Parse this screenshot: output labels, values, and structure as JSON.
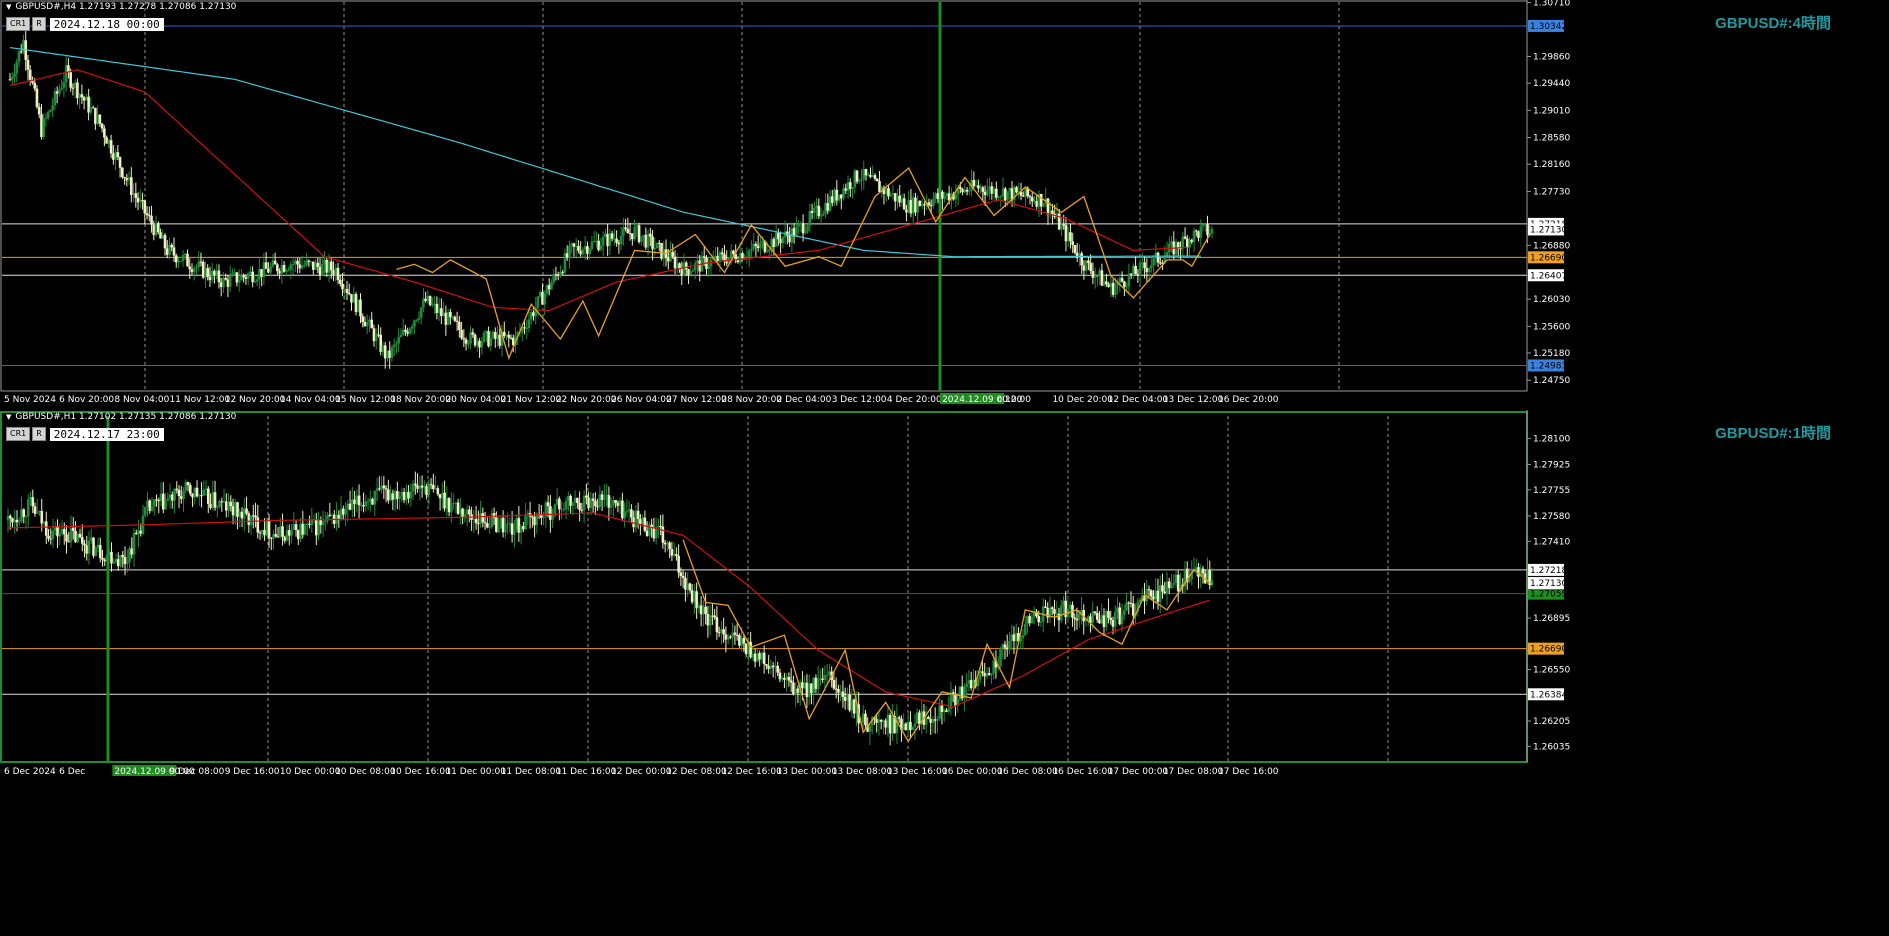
{
  "colors": {
    "bull": "#1e8c3c",
    "bear": "#f0f0c0",
    "ma_fast": "#d01010",
    "ma_slow": "#3fc8d8",
    "zigzag": "#e8a21c",
    "grid": "#c8c8c8",
    "accent_label": "#1e9aa0",
    "blue_line": "#2f66c8",
    "orange_line": "#e89a20",
    "green_vline": "#1e8c1e"
  },
  "panels": [
    {
      "id": "h4",
      "header": "GBPUSD#,H4  1.27193 1.27278 1.27086 1.27130",
      "btn1": "CR1",
      "btn2": "R",
      "datetime": "2024.12.18 00:00",
      "title": "GBPUSD#:4時間",
      "ylim": [
        1.2458,
        1.3072
      ],
      "yticks": [
        "1.30710",
        "1.29860",
        "1.29440",
        "1.29010",
        "1.28580",
        "1.28160",
        "1.27730",
        "1.26880",
        "1.26030",
        "1.25600",
        "1.25180",
        "1.24750"
      ],
      "xticks": [
        "5 Nov 2024",
        "6 Nov 20:00",
        "8 Nov 04:00",
        "11 Nov 12:00",
        "12 Nov 20:00",
        "14 Nov 04:00",
        "15 Nov 12:00",
        "18 Nov 20:00",
        "20 Nov 04:00",
        "21 Nov 12:00",
        "22 Nov 20:00",
        "26 Nov 04:00",
        "27 Nov 12:00",
        "28 Nov 20:00",
        "2 Dec 04:00",
        "3 Dec 12:00",
        "4 Dec 20:00",
        "2024.12.09 00:00",
        "c 12:00",
        "10 Dec 20:00",
        "12 Dec 04:00",
        "13 Dec 12:00",
        "16 Dec 20:00"
      ],
      "hlines": [
        {
          "label": "1.30342",
          "value": 1.30342,
          "kind": "blue"
        },
        {
          "label": "1.27218",
          "value": 1.27218,
          "kind": "white"
        },
        {
          "label": "1.26690",
          "value": 1.2669,
          "kind": "orange"
        },
        {
          "label": "1.26407",
          "value": 1.26407,
          "kind": "white"
        },
        {
          "label": "1.24983",
          "value": 1.24983,
          "kind": "blue"
        }
      ],
      "price_tag": "1.27130",
      "price_value": 1.2713
    },
    {
      "id": "h1",
      "header": "GBPUSD#,H1  1.27102 1.27135 1.27086 1.27130",
      "btn1": "CR1",
      "btn2": "R",
      "datetime": "2024.12.17 23:00",
      "title": "GBPUSD#:1時間",
      "ylim": [
        1.2593,
        1.2825
      ],
      "yticks": [
        "1.28100",
        "1.27925",
        "1.27755",
        "1.27580",
        "1.27410",
        "1.26895",
        "1.26550",
        "1.26205",
        "1.26035"
      ],
      "xticks": [
        "6 Dec 2024",
        "6 Dec",
        "2024.12.09 00:00",
        "9 Dec 08:00",
        "9 Dec 16:00",
        "10 Dec 00:00",
        "10 Dec 08:00",
        "10 Dec 16:00",
        "11 Dec 00:00",
        "11 Dec 08:00",
        "11 Dec 16:00",
        "12 Dec 00:00",
        "12 Dec 08:00",
        "12 Dec 16:00",
        "13 Dec 00:00",
        "13 Dec 08:00",
        "13 Dec 16:00",
        "16 Dec 00:00",
        "16 Dec 08:00",
        "16 Dec 16:00",
        "17 Dec 00:00",
        "17 Dec 08:00",
        "17 Dec 16:00"
      ],
      "hlines": [
        {
          "label": "1.27218",
          "value": 1.27218,
          "kind": "white"
        },
        {
          "label": "1.27059",
          "value": 1.27059,
          "kind": "green"
        },
        {
          "label": "1.26690",
          "value": 1.2669,
          "kind": "orange"
        },
        {
          "label": "1.26384",
          "value": 1.26384,
          "kind": "white"
        }
      ],
      "price_tag": "1.27130",
      "price_value": 1.2713
    }
  ],
  "chart_data": [
    {
      "type": "candlestick",
      "symbol": "GBPUSD#",
      "timeframe": "H4",
      "anchors": [
        [
          0,
          1.295
        ],
        [
          6,
          1.301
        ],
        [
          14,
          1.287
        ],
        [
          25,
          1.296
        ],
        [
          40,
          1.288
        ],
        [
          55,
          1.277
        ],
        [
          70,
          1.268
        ],
        [
          95,
          1.263
        ],
        [
          125,
          1.266
        ],
        [
          145,
          1.265
        ],
        [
          168,
          1.251
        ],
        [
          185,
          1.26
        ],
        [
          205,
          1.254
        ],
        [
          225,
          1.254
        ],
        [
          250,
          1.268
        ],
        [
          278,
          1.271
        ],
        [
          300,
          1.265
        ],
        [
          330,
          1.268
        ],
        [
          350,
          1.271
        ],
        [
          378,
          1.28
        ],
        [
          400,
          1.275
        ],
        [
          430,
          1.278
        ],
        [
          460,
          1.276
        ],
        [
          478,
          1.266
        ],
        [
          490,
          1.262
        ],
        [
          508,
          1.266
        ],
        [
          525,
          1.27
        ],
        [
          530,
          1.271
        ]
      ],
      "ma_slow": [
        [
          0,
          1.3
        ],
        [
          100,
          1.295
        ],
        [
          200,
          1.285
        ],
        [
          300,
          1.274
        ],
        [
          380,
          1.268
        ],
        [
          420,
          1.267
        ],
        [
          530,
          1.2671
        ]
      ],
      "ma_fast": [
        [
          0,
          1.294
        ],
        [
          30,
          1.2965
        ],
        [
          60,
          1.293
        ],
        [
          100,
          1.28
        ],
        [
          140,
          1.267
        ],
        [
          180,
          1.263
        ],
        [
          215,
          1.259
        ],
        [
          240,
          1.2585
        ],
        [
          270,
          1.263
        ],
        [
          310,
          1.266
        ],
        [
          360,
          1.268
        ],
        [
          400,
          1.272
        ],
        [
          440,
          1.276
        ],
        [
          470,
          1.273
        ],
        [
          500,
          1.268
        ],
        [
          525,
          1.2685
        ]
      ],
      "zigzag": [
        [
          172,
          1.265
        ],
        [
          180,
          1.2658
        ],
        [
          188,
          1.2645
        ],
        [
          196,
          1.2665
        ],
        [
          212,
          1.2635
        ],
        [
          222,
          1.251
        ],
        [
          232,
          1.2595
        ],
        [
          245,
          1.254
        ],
        [
          255,
          1.26
        ],
        [
          262,
          1.2545
        ],
        [
          278,
          1.268
        ],
        [
          292,
          1.2675
        ],
        [
          305,
          1.2705
        ],
        [
          318,
          1.2645
        ],
        [
          330,
          1.272
        ],
        [
          345,
          1.2655
        ],
        [
          360,
          1.267
        ],
        [
          370,
          1.2655
        ],
        [
          385,
          1.2765
        ],
        [
          400,
          1.281
        ],
        [
          412,
          1.2725
        ],
        [
          425,
          1.2795
        ],
        [
          438,
          1.2735
        ],
        [
          452,
          1.278
        ],
        [
          468,
          1.274
        ],
        [
          478,
          1.2765
        ],
        [
          490,
          1.264
        ],
        [
          500,
          1.2605
        ],
        [
          515,
          1.2665
        ],
        [
          522,
          1.2665
        ],
        [
          526,
          1.2655
        ],
        [
          534,
          1.2705
        ]
      ]
    },
    {
      "type": "candlestick",
      "symbol": "GBPUSD#",
      "timeframe": "H1",
      "anchors": [
        [
          0,
          1.2755
        ],
        [
          10,
          1.2765
        ],
        [
          18,
          1.2748
        ],
        [
          28,
          1.2745
        ],
        [
          40,
          1.2735
        ],
        [
          52,
          1.2728
        ],
        [
          62,
          1.2762
        ],
        [
          80,
          1.2775
        ],
        [
          100,
          1.2762
        ],
        [
          120,
          1.2745
        ],
        [
          140,
          1.2752
        ],
        [
          160,
          1.277
        ],
        [
          185,
          1.2778
        ],
        [
          205,
          1.2758
        ],
        [
          225,
          1.275
        ],
        [
          245,
          1.2765
        ],
        [
          265,
          1.277
        ],
        [
          290,
          1.2745
        ],
        [
          310,
          1.269
        ],
        [
          330,
          1.2668
        ],
        [
          350,
          1.264
        ],
        [
          365,
          1.2648
        ],
        [
          380,
          1.262
        ],
        [
          395,
          1.2618
        ],
        [
          410,
          1.2625
        ],
        [
          425,
          1.264
        ],
        [
          440,
          1.2662
        ],
        [
          455,
          1.269
        ],
        [
          470,
          1.2695
        ],
        [
          490,
          1.2688
        ],
        [
          505,
          1.2702
        ],
        [
          518,
          1.2712
        ],
        [
          528,
          1.272
        ],
        [
          535,
          1.2713
        ]
      ],
      "ma_fast": [
        [
          0,
          1.275
        ],
        [
          60,
          1.2752
        ],
        [
          120,
          1.2755
        ],
        [
          200,
          1.2757
        ],
        [
          260,
          1.276
        ],
        [
          300,
          1.2745
        ],
        [
          330,
          1.271
        ],
        [
          360,
          1.2668
        ],
        [
          390,
          1.264
        ],
        [
          420,
          1.263
        ],
        [
          450,
          1.265
        ],
        [
          480,
          1.2675
        ],
        [
          510,
          1.269
        ],
        [
          535,
          1.2702
        ]
      ],
      "zigzag": [
        [
          300,
          1.2742
        ],
        [
          310,
          1.27
        ],
        [
          320,
          1.2698
        ],
        [
          330,
          1.267
        ],
        [
          345,
          1.2678
        ],
        [
          356,
          1.2622
        ],
        [
          372,
          1.2668
        ],
        [
          380,
          1.2613
        ],
        [
          390,
          1.2633
        ],
        [
          400,
          1.2607
        ],
        [
          415,
          1.264
        ],
        [
          428,
          1.2636
        ],
        [
          435,
          1.2672
        ],
        [
          445,
          1.2643
        ],
        [
          452,
          1.2695
        ],
        [
          465,
          1.269
        ],
        [
          475,
          1.2695
        ],
        [
          485,
          1.268
        ],
        [
          495,
          1.2672
        ],
        [
          505,
          1.2705
        ],
        [
          515,
          1.2695
        ],
        [
          527,
          1.2722
        ],
        [
          535,
          1.2712
        ]
      ]
    }
  ]
}
